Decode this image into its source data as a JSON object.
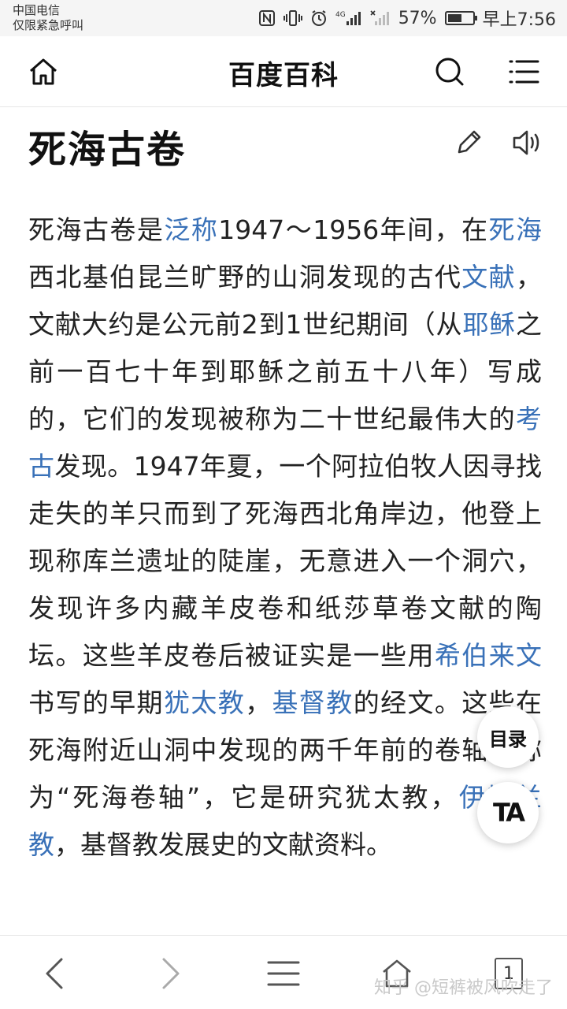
{
  "status_bar": {
    "carrier_line1": "中国电信",
    "carrier_line2": "仅限紧急呼叫",
    "battery_level_text": "57%",
    "battery_level": 0.57,
    "time": "早上7:56",
    "network_label": "4G"
  },
  "header": {
    "title": "百度百科"
  },
  "article": {
    "title": "死海古卷",
    "paragraph": [
      {
        "t": "死海古卷是"
      },
      {
        "t": "泛称",
        "link": true
      },
      {
        "t": "1947～1956年间，在"
      },
      {
        "t": "死海",
        "link": true
      },
      {
        "t": "西北基伯昆兰旷野的山洞发现的古代"
      },
      {
        "t": "文献",
        "link": true
      },
      {
        "t": "，文献大约是公元前2到1世纪期间（从"
      },
      {
        "t": "耶稣",
        "link": true
      },
      {
        "t": "之前一百七十年到耶稣之前五十八年）写成的，它们的发现被称为二十世纪最伟大的"
      },
      {
        "t": "考古",
        "link": true
      },
      {
        "t": "发现。1947年夏，一个阿拉伯牧人因寻找走失的羊只而到了死海西北角岸边，他登上现称库兰遗址的陡崖，无意进入一个洞穴，发现许多内藏羊皮卷和纸莎草卷文献的陶坛。这些羊皮卷后被证实是一些用"
      },
      {
        "t": "希伯来文",
        "link": true
      },
      {
        "t": "书写的早期"
      },
      {
        "t": "犹太教",
        "link": true
      },
      {
        "t": "，"
      },
      {
        "t": "基督教",
        "link": true
      },
      {
        "t": "的经文。这些在死海附近山洞中发现的两千年前的卷轴统称为“死海卷轴”，它是研究犹太教，"
      },
      {
        "t": "伊斯兰教",
        "link": true
      },
      {
        "t": "，基督教发展史的文献资料。"
      }
    ]
  },
  "floating": {
    "toc_label": "目录",
    "text_size_label": "TA"
  },
  "bottom_bar": {
    "tab_count": "1",
    "watermark": "知乎 @短裤被风吹走了"
  }
}
